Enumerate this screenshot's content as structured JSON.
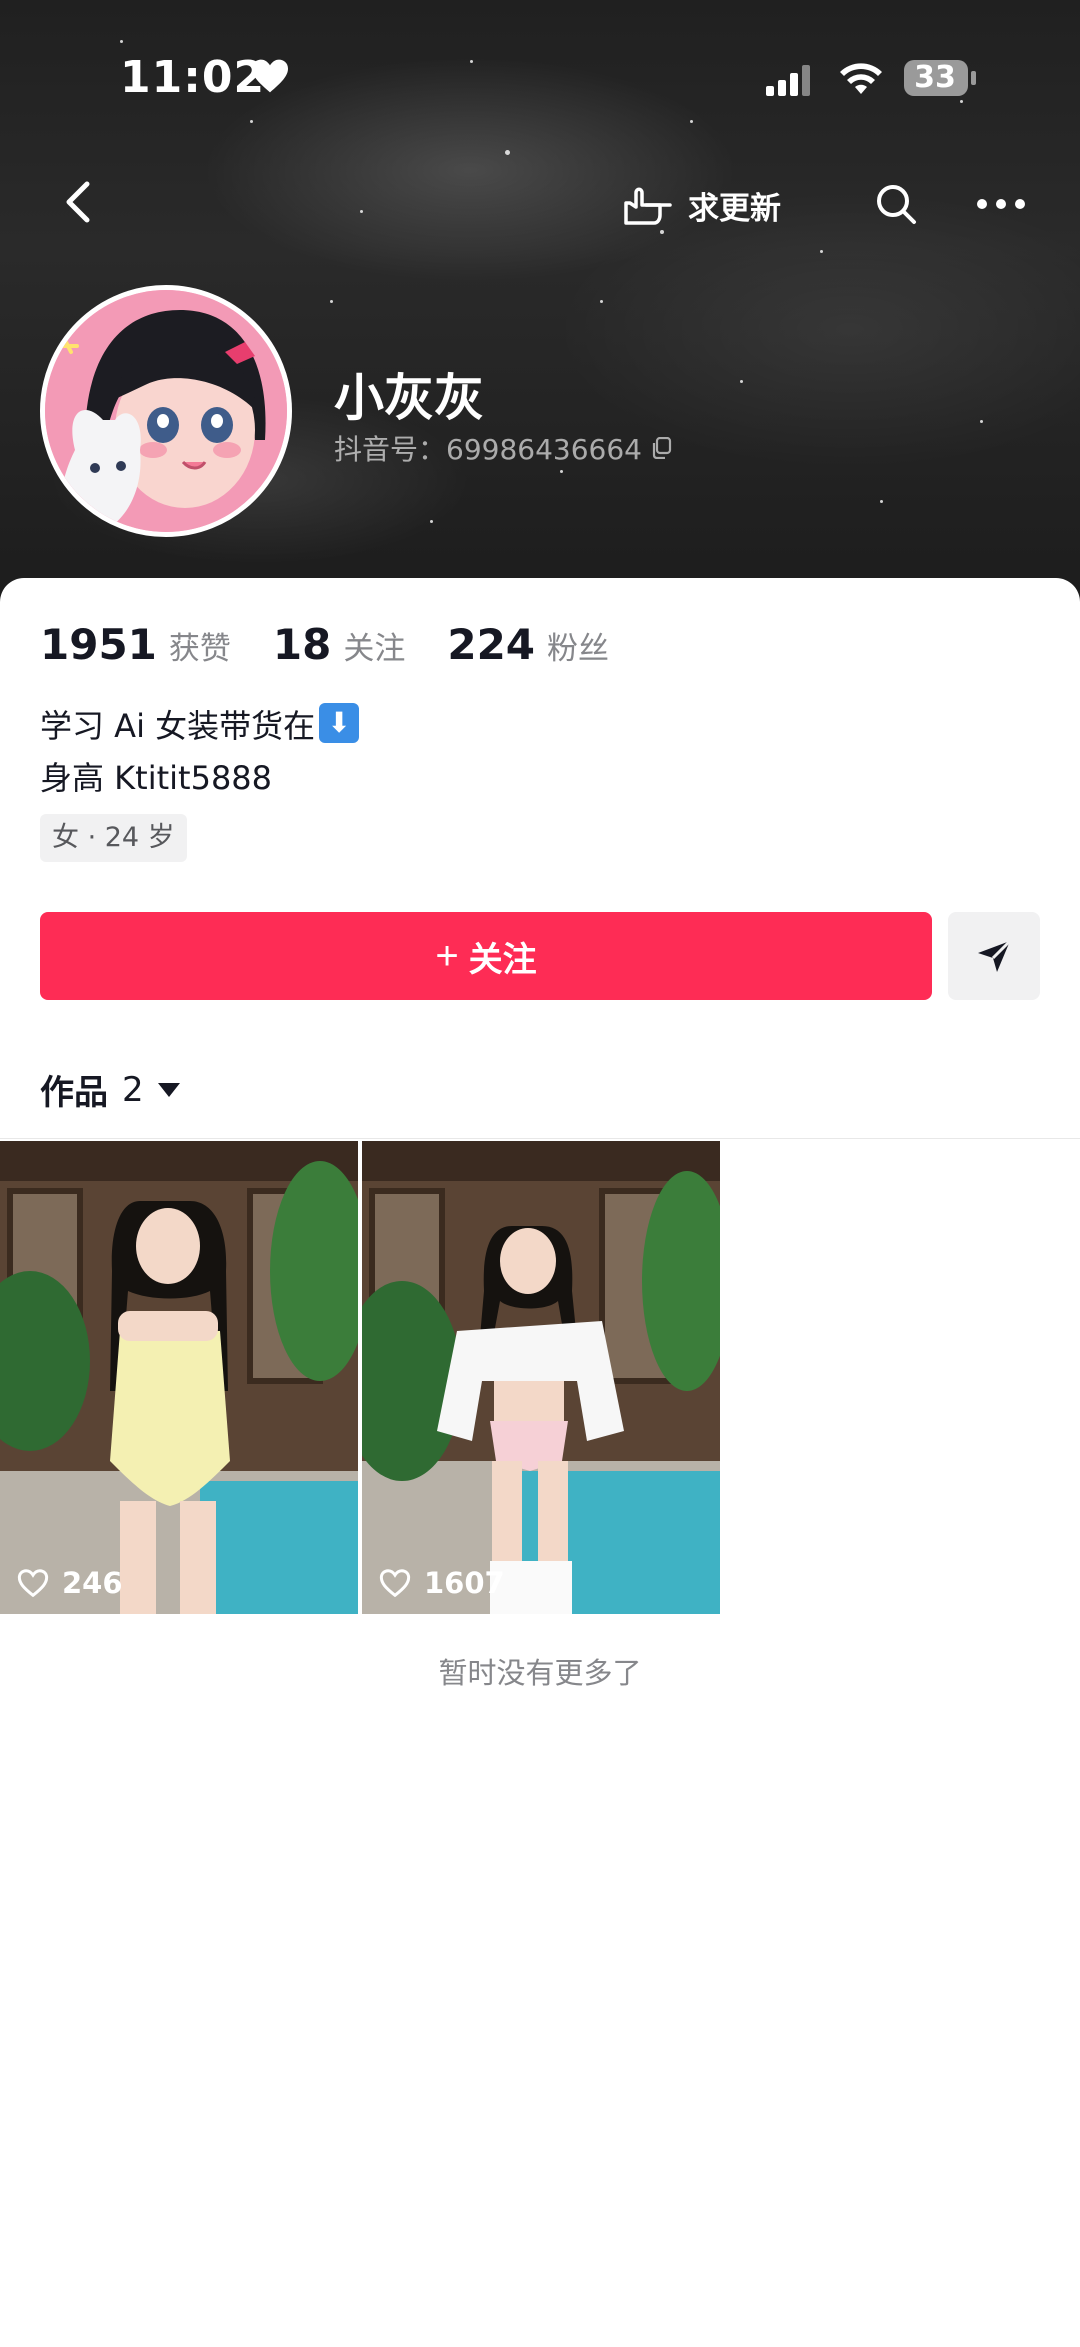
{
  "status_bar": {
    "time": "11:02",
    "battery": "33"
  },
  "nav": {
    "update_label": "求更新"
  },
  "profile": {
    "name": "小灰灰",
    "douyin_id": "抖音号：69986436664"
  },
  "stats": [
    {
      "num": "1951",
      "label": "获赞"
    },
    {
      "num": "18",
      "label": "关注"
    },
    {
      "num": "224",
      "label": "粉丝"
    }
  ],
  "bio": {
    "line1": "学习 Ai 女装带货在",
    "line2": "身高 Ktitit5888"
  },
  "tag": "女 · 24 岁",
  "follow_button": {
    "plus": "+",
    "label": "关注"
  },
  "works_tab": {
    "label": "作品",
    "count": "2"
  },
  "videos": [
    {
      "likes": "246"
    },
    {
      "likes": "1607"
    }
  ],
  "footer": "暂时没有更多了",
  "colors": {
    "accent": "#fe2c55",
    "muted": "#86878b"
  }
}
